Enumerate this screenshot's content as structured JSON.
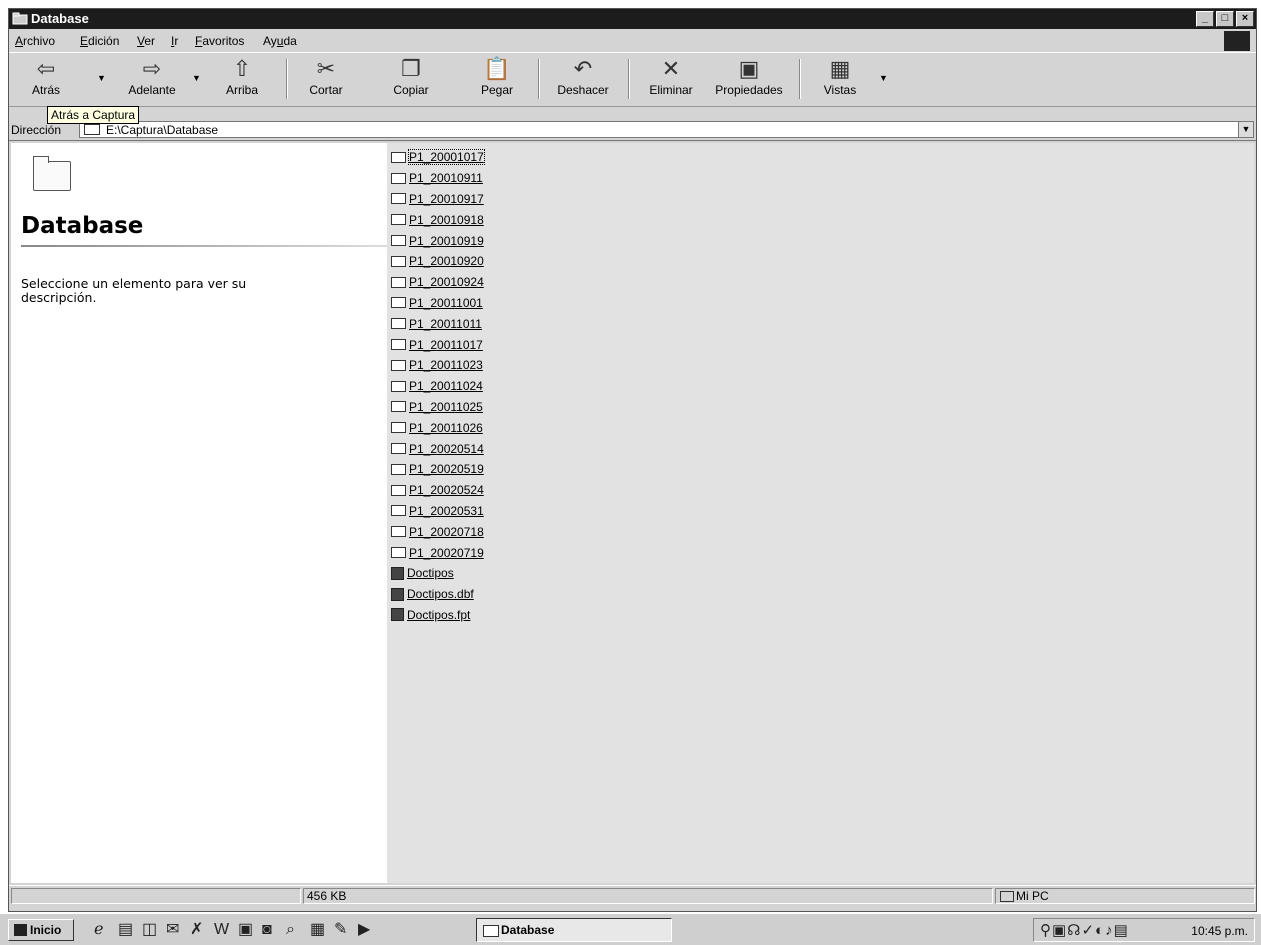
{
  "window": {
    "title": "Database",
    "controls": {
      "minimize": "_",
      "maximize": "□",
      "close": "×"
    }
  },
  "menu": {
    "items": [
      {
        "first": "A",
        "rest": "rchivo"
      },
      {
        "first": "E",
        "rest": "dición"
      },
      {
        "first": "V",
        "rest": "er"
      },
      {
        "first": "I",
        "rest": "r"
      },
      {
        "first": "F",
        "rest": "avoritos"
      },
      {
        "pre": "Ay",
        "first": "u",
        "rest": "da"
      }
    ]
  },
  "toolbar": {
    "back": {
      "label": "Atrás",
      "icon": "back-arrow-icon",
      "glyph": "⇦"
    },
    "forward": {
      "label": "Adelante",
      "icon": "forward-arrow-icon",
      "glyph": "⇨"
    },
    "up": {
      "label": "Arriba",
      "icon": "up-folder-icon",
      "glyph": "⇧"
    },
    "cut": {
      "label": "Cortar",
      "icon": "scissors-icon",
      "glyph": "✂"
    },
    "copy": {
      "label": "Copiar",
      "icon": "copy-icon",
      "glyph": "❐"
    },
    "paste": {
      "label": "Pegar",
      "icon": "paste-icon",
      "glyph": "📋"
    },
    "undo": {
      "label": "Deshacer",
      "icon": "undo-icon",
      "glyph": "↶"
    },
    "delete": {
      "label": "Eliminar",
      "icon": "delete-icon",
      "glyph": "✕"
    },
    "properties": {
      "label": "Propiedades",
      "icon": "properties-icon",
      "glyph": "▣"
    },
    "views": {
      "label": "Vistas",
      "icon": "views-icon",
      "glyph": "▦"
    }
  },
  "tooltip": "Atrás a Captura",
  "address": {
    "label": "Dirección",
    "value": "E:\\Captura\\Database"
  },
  "left_pane": {
    "folder_title": "Database",
    "description": "Seleccione un elemento para ver su descripción."
  },
  "files": [
    {
      "name": "P1_20001017",
      "type": "folder"
    },
    {
      "name": "P1_20010911",
      "type": "folder"
    },
    {
      "name": "P1_20010917",
      "type": "folder"
    },
    {
      "name": "P1_20010918",
      "type": "folder"
    },
    {
      "name": "P1_20010919",
      "type": "folder"
    },
    {
      "name": "P1_20010920",
      "type": "folder"
    },
    {
      "name": "P1_20010924",
      "type": "folder"
    },
    {
      "name": "P1_20011001",
      "type": "folder"
    },
    {
      "name": "P1_20011011",
      "type": "folder"
    },
    {
      "name": "P1_20011017",
      "type": "folder"
    },
    {
      "name": "P1_20011023",
      "type": "folder"
    },
    {
      "name": "P1_20011024",
      "type": "folder"
    },
    {
      "name": "P1_20011025",
      "type": "folder"
    },
    {
      "name": "P1_20011026",
      "type": "folder"
    },
    {
      "name": "P1_20020514",
      "type": "folder"
    },
    {
      "name": "P1_20020519",
      "type": "folder"
    },
    {
      "name": "P1_20020524",
      "type": "folder"
    },
    {
      "name": "P1_20020531",
      "type": "folder"
    },
    {
      "name": "P1_20020718",
      "type": "folder"
    },
    {
      "name": "P1_20020719",
      "type": "folder"
    },
    {
      "name": "Doctipos",
      "type": "file"
    },
    {
      "name": "Doctipos.dbf",
      "type": "file"
    },
    {
      "name": "Doctipos.fpt",
      "type": "file"
    }
  ],
  "status": {
    "size": "456 KB",
    "location": "Mi PC"
  },
  "taskbar": {
    "start_label": "Inicio",
    "task_label": "Database",
    "clock": "10:45 p.m."
  }
}
